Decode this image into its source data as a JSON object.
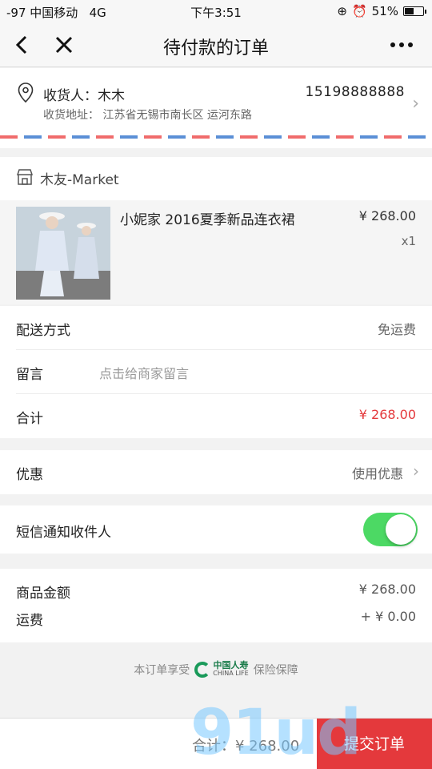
{
  "status": {
    "carrier": "-97 中国移动",
    "network": "4G",
    "time": "下午3:51",
    "battery": "51%",
    "battery_level": 0.51
  },
  "nav": {
    "title": "待付款的订单"
  },
  "address": {
    "recipient_label": "收货人：木木",
    "phone": "15198888888",
    "address_line": "收货地址： 江苏省无锡市南长区 运河东路"
  },
  "store": {
    "name": "木友-Market"
  },
  "product": {
    "title": "小妮家 2016夏季新品连衣裙",
    "price": "¥ 268.00",
    "qty": "x1"
  },
  "rows": {
    "delivery_label": "配送方式",
    "delivery_value": "免运费",
    "note_label": "留言",
    "note_placeholder": "点击给商家留言",
    "total_label": "合计",
    "total_value": "¥ 268.00"
  },
  "coupon": {
    "label": "优惠",
    "value": "使用优惠"
  },
  "sms": {
    "label": "短信通知收件人",
    "enabled": true
  },
  "summary": {
    "goods_label": "商品金额",
    "goods_value": "¥ 268.00",
    "shipping_label": "运费",
    "shipping_value": "+ ¥ 0.00"
  },
  "guarantee": {
    "prefix": "本订单享受",
    "logo_cn": "中国人寿",
    "logo_en": "CHINA LIFE",
    "suffix": "保险保障"
  },
  "bottom": {
    "total": "合计：¥ 268.00",
    "submit": "提交订单"
  },
  "watermark": "91ud",
  "colors": {
    "accent_red": "#e4393c",
    "toggle_green": "#4cd964"
  }
}
